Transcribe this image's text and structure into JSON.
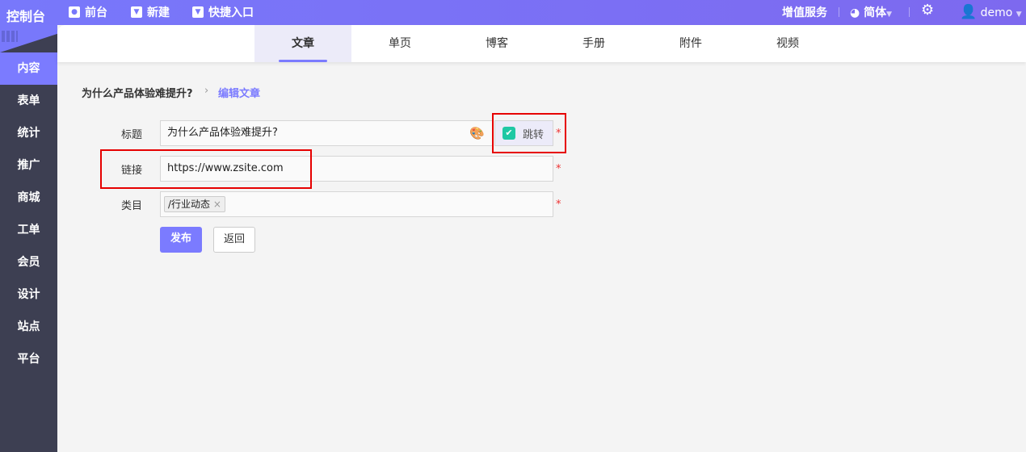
{
  "logo": "控制台",
  "topnav": [
    {
      "icon": "eye-icon",
      "label": "前台"
    },
    {
      "icon": "caret-down-box-icon",
      "label": "新建"
    },
    {
      "icon": "caret-down-box-icon",
      "label": "快捷入口"
    }
  ],
  "topright": {
    "value_added": "增值服务",
    "language": "简体",
    "user": "demo"
  },
  "sidebar": [
    "内容",
    "表单",
    "统计",
    "推广",
    "商城",
    "工单",
    "会员",
    "设计",
    "站点",
    "平台"
  ],
  "tabs": [
    "文章",
    "单页",
    "博客",
    "手册",
    "附件",
    "视频"
  ],
  "breadcrumb": {
    "parent": "为什么产品体验难提升?",
    "current": "编辑文章",
    "separator": "›"
  },
  "form": {
    "title_label": "标题",
    "title_value": "为什么产品体验难提升?",
    "jump_label": "跳转",
    "link_label": "链接",
    "link_value": "https://www.zsite.com",
    "category_label": "类目",
    "category_tag": "/行业动态",
    "tag_remove": "×",
    "required": "*",
    "publish": "发布",
    "back": "返回"
  },
  "colors": {
    "accent": "#7b7bff",
    "sidebar": "#3d3f52",
    "check": "#1fc8a4",
    "highlight": "#e60000"
  }
}
